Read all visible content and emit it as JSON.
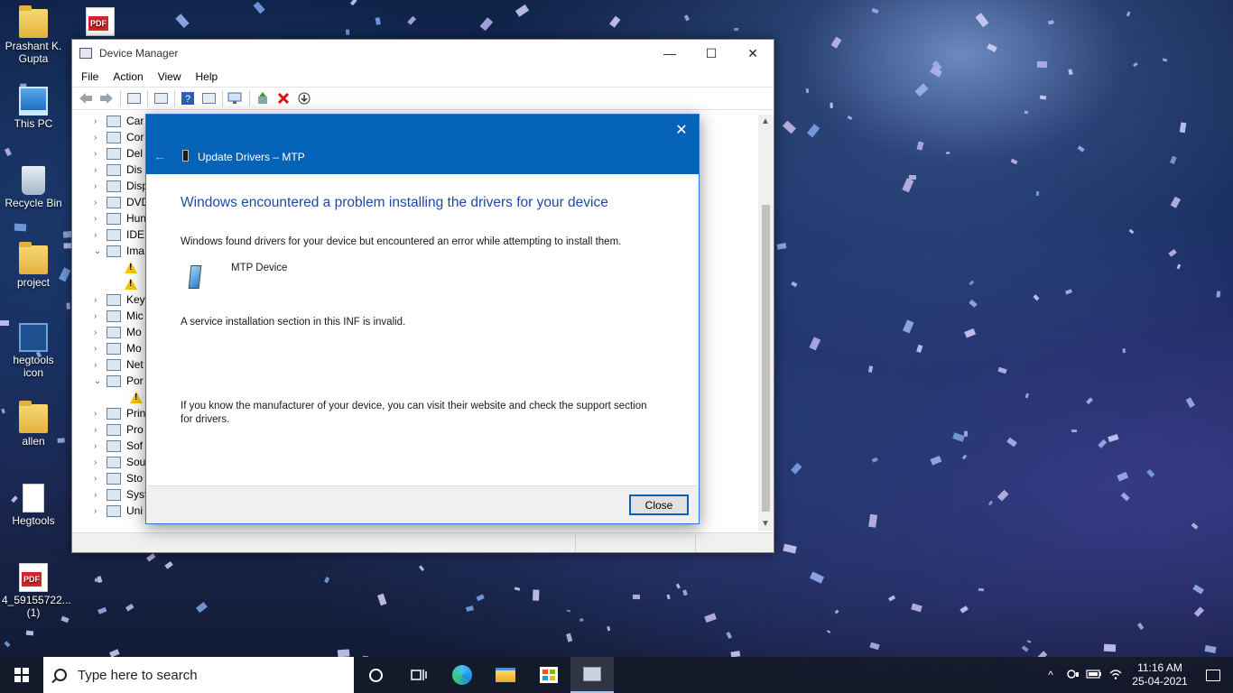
{
  "desktop": {
    "icons": [
      {
        "label": "Prashant K. Gupta"
      },
      {
        "label": "This PC"
      },
      {
        "label": "Recycle Bin"
      },
      {
        "label": "project"
      },
      {
        "label": "hegtools icon"
      },
      {
        "label": "allen"
      },
      {
        "label": "Hegtools"
      },
      {
        "label": "4_59155722... (1)"
      }
    ],
    "top_pdf_label": "PDF",
    "pdf_badge": "PDF"
  },
  "device_manager": {
    "title": "Device Manager",
    "window_controls": {
      "minimize": "—",
      "maximize": "☐",
      "close": "✕"
    },
    "menu": [
      "File",
      "Action",
      "View",
      "Help"
    ],
    "tree_items": [
      {
        "label": "Car",
        "expanded": false
      },
      {
        "label": "Cor",
        "expanded": false
      },
      {
        "label": "Del",
        "expanded": false
      },
      {
        "label": "Dis",
        "expanded": false
      },
      {
        "label": "Disp",
        "expanded": false
      },
      {
        "label": "DVD",
        "expanded": false
      },
      {
        "label": "Hun",
        "expanded": false
      },
      {
        "label": "IDE",
        "expanded": false
      },
      {
        "label": "Ima",
        "expanded": true
      },
      {
        "label": "",
        "child": true,
        "warning": true
      },
      {
        "label": "",
        "child": true,
        "warning": true
      },
      {
        "label": "Key",
        "expanded": false
      },
      {
        "label": "Mic",
        "expanded": false
      },
      {
        "label": "Mo",
        "expanded": false
      },
      {
        "label": "Mo",
        "expanded": false
      },
      {
        "label": "Net",
        "expanded": false
      },
      {
        "label": "Por",
        "expanded": true
      },
      {
        "label": "",
        "child": true,
        "warning": true
      },
      {
        "label": "Prin",
        "expanded": false
      },
      {
        "label": "Pro",
        "expanded": false
      },
      {
        "label": "Sof",
        "expanded": false
      },
      {
        "label": "Sou",
        "expanded": false
      },
      {
        "label": "Sto",
        "expanded": false
      },
      {
        "label": "Syst",
        "expanded": false
      },
      {
        "label": "Uni",
        "expanded": false
      }
    ]
  },
  "dialog": {
    "title": "Update Drivers – MTP",
    "heading": "Windows encountered a problem installing the drivers for your device",
    "intro": "Windows found drivers for your device but encountered an error while attempting to install them.",
    "device_name": "MTP Device",
    "error": "A service installation section in this INF is invalid.",
    "help": "If you know the manufacturer of your device, you can visit their website and check the support section for drivers.",
    "close_label": "Close",
    "close_x": "✕",
    "back_arrow": "←"
  },
  "taskbar": {
    "search_placeholder": "Type here to search",
    "time": "11:16 AM",
    "date": "25-04-2021",
    "tray_chevron": "^"
  },
  "colors": {
    "dialog_header": "#0563b7",
    "heading_text": "#1f4aa8",
    "warning": "#f5c800"
  }
}
